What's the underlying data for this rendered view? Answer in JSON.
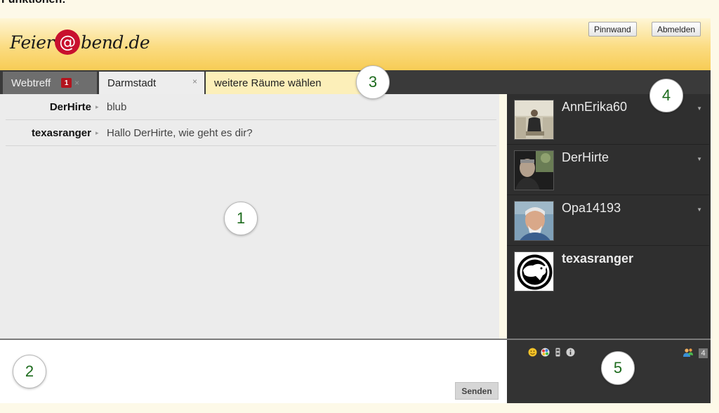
{
  "page": {
    "heading": "Funktionen:"
  },
  "header": {
    "logo_prefix": "Feier",
    "logo_at": "@",
    "logo_suffix": "bend.de",
    "buttons": {
      "pinnwand": "Pinnwand",
      "abmelden": "Abmelden"
    }
  },
  "tabs": [
    {
      "label": "Webtreff",
      "badge": "1",
      "close": "×"
    },
    {
      "label": "Darmstadt",
      "close": "×"
    },
    {
      "label": "weitere Räume wählen"
    }
  ],
  "messages": [
    {
      "user": "DerHirte",
      "arrow": "▸",
      "text": "blub"
    },
    {
      "user": "texasranger",
      "arrow": "▸",
      "text": "Hallo DerHirte, wie geht es dir?"
    }
  ],
  "users": [
    {
      "name": "AnnErika60",
      "menu": "▼"
    },
    {
      "name": "DerHirte",
      "menu": "▼"
    },
    {
      "name": "Opa14193",
      "menu": "▼"
    },
    {
      "name": "texasranger"
    }
  ],
  "composer": {
    "send_label": "Senden"
  },
  "toolbar": {
    "icons": [
      "smiley-icon",
      "color-palette-icon",
      "device-icon",
      "info-icon",
      "users-icon"
    ],
    "user_count": "4"
  },
  "callouts": [
    "1",
    "2",
    "3",
    "4",
    "5"
  ],
  "colors": {
    "accent_red": "#c8102e",
    "header_gold": "#f7cc55",
    "dark_panel": "#2f2f2f",
    "callout_green": "#1d6b1d"
  }
}
